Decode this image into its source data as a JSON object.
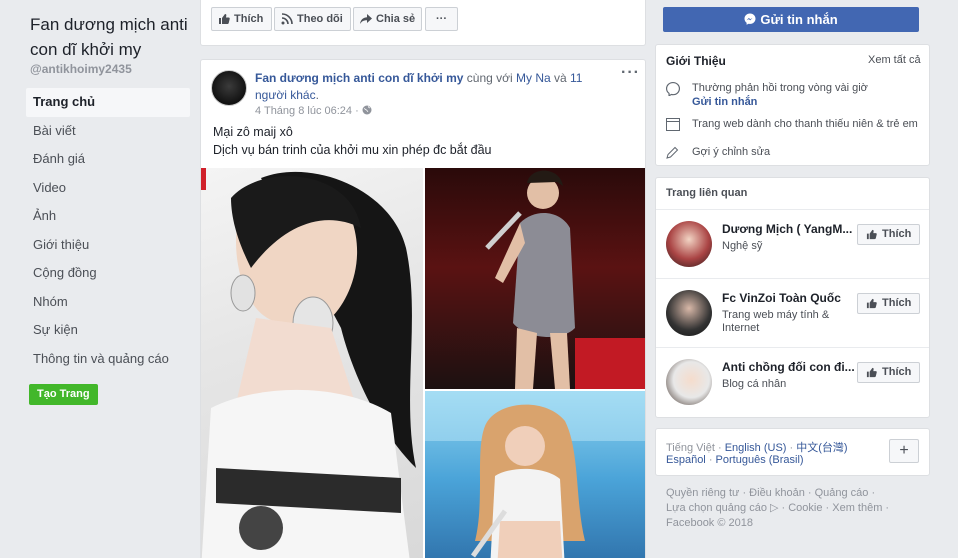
{
  "sidebar": {
    "page_name": "Fan dương mịch anti con dĩ khởi my",
    "handle": "@antikhoimy2435",
    "items": [
      {
        "label": "Trang chủ"
      },
      {
        "label": "Bài viết"
      },
      {
        "label": "Đánh giá"
      },
      {
        "label": "Video"
      },
      {
        "label": "Ảnh"
      },
      {
        "label": "Giới thiệu"
      },
      {
        "label": "Cộng đồng"
      },
      {
        "label": "Nhóm"
      },
      {
        "label": "Sự kiện"
      },
      {
        "label": "Thông tin và quảng cáo"
      }
    ],
    "create_page": "Tạo Trang"
  },
  "actions": {
    "like": "Thích",
    "follow": "Theo dõi",
    "share": "Chia sẻ",
    "more": "···"
  },
  "post": {
    "author": "Fan dương mịch anti con dĩ khởi my",
    "with_text": " cùng với ",
    "tagged": "My Na",
    "and_text": " và ",
    "others": "11 người khác",
    "period": ".",
    "time": "4 Tháng 8 lúc 06:24 · ",
    "more": "···",
    "line1": "Mại zô maij xô",
    "line2": "Dịch vụ bán trinh của khởi mu xin phép đc bắt đầu"
  },
  "right": {
    "send_message": "Gửi tin nhắn",
    "about": {
      "title": "Giới Thiệu",
      "see_all": "Xem tất cả",
      "response": "Thường phản hồi trong vòng vài giờ",
      "send_link": "Gửi tin nhắn",
      "website": "Trang web dành cho thanh thiếu niên & trẻ em",
      "suggest": "Gợi ý chỉnh sửa"
    },
    "related": {
      "title": "Trang liên quan",
      "items": [
        {
          "name": "Dương Mịch ( YangM...",
          "category": "Nghệ sỹ",
          "button": "Thích"
        },
        {
          "name": "Fc VinZoi Toàn Quốc",
          "category": "Trang web máy tính & Internet",
          "button": "Thích"
        },
        {
          "name": "Anti chồng đối con đi...",
          "category": "Blog cá nhân",
          "button": "Thích"
        }
      ]
    },
    "languages": {
      "current": "Tiếng Việt",
      "sep": " · ",
      "options": [
        "English (US)",
        "中文(台灣)",
        "Español",
        "Português (Brasil)"
      ],
      "add": "+"
    },
    "footer": {
      "line1": "Quyền riêng tư · Điều khoản · Quảng cáo ·",
      "line2": "Lựa chọn quảng cáo ▷ · Cookie · Xem thêm ·",
      "line3": "Facebook © 2018"
    }
  },
  "colors": {
    "brand": "#4267b2",
    "link": "#365899",
    "green": "#42b72a",
    "background": "#e9ebee"
  }
}
